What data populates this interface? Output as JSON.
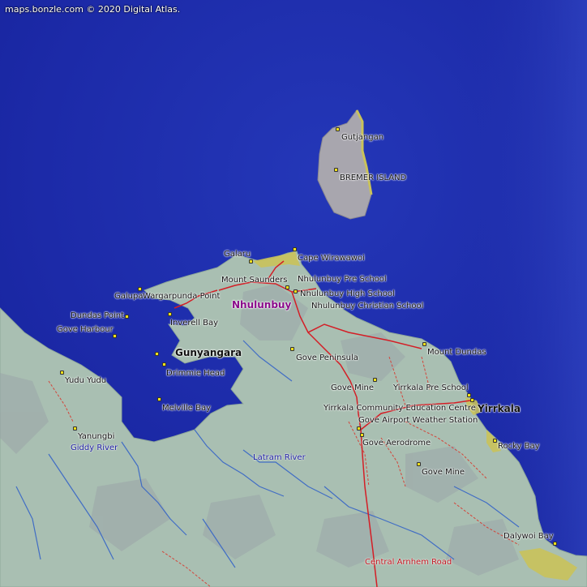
{
  "credit": "maps.bonzle.com © 2020 Digital Atlas.",
  "colors": {
    "sea": "#1c2aa8",
    "land": "#a9bfb2",
    "island": "#a8a6ae",
    "sand": "#c9c25a",
    "road": "#d41e26",
    "track": "#d4443a",
    "river": "#2f5fc8",
    "town_label": "#8a0a8a",
    "water_label": "#1a1aa0",
    "road_label": "#c0101a"
  },
  "labels": {
    "gutjangan": "Gutjangan",
    "bremer_island": "BREMER ISLAND",
    "galaru": "Galaru",
    "cape_wirawawoi": "Cape Wirawawoi",
    "mount_saunders": "Mount Saunders",
    "nhulunbuy_pre_school": "Nhulunbuy Pre School",
    "galupa": "Galupa",
    "wargarpunda_point": "Wargarpunda Point",
    "nhulunbuy_high_school": "Nhulunbuy High School",
    "nhulunbuy": "Nhulunbuy",
    "nhulunbuy_christian_school": "Nhulunbuy Christian School",
    "dundas_point": "Dundas Point",
    "gove_harbour": "Gove Harbour",
    "inverell_bay": "Inverell Bay",
    "gunyangara": "Gunyangara",
    "gove_peninsula": "Gove Peninsula",
    "mount_dundas": "Mount Dundas",
    "yudu_yudu": "Yudu Yudu",
    "drimmie_head": "Drimmie Head",
    "gove_mine_north": "Gove Mine",
    "yirrkala_pre_school": "Yirrkala Pre School",
    "melville_bay": "Melville Bay",
    "yirrkala_community_education_centre": "Yirrkala Community Education Centre",
    "yirrkala": "Yirrkala",
    "gove_airport_weather_station": "Gove Airport Weather Station",
    "yanungbi": "Yanungbi",
    "giddy_river": "Giddy River",
    "gove_aerodrome": "Gove Aerodrome",
    "rocky_bay": "Rocky Bay",
    "latram_river": "Latram River",
    "gove_mine_south": "Gove Mine",
    "dalywoi_bay": "Dalywoi Bay",
    "central_arnhem_road": "Central Arnhem Road"
  }
}
